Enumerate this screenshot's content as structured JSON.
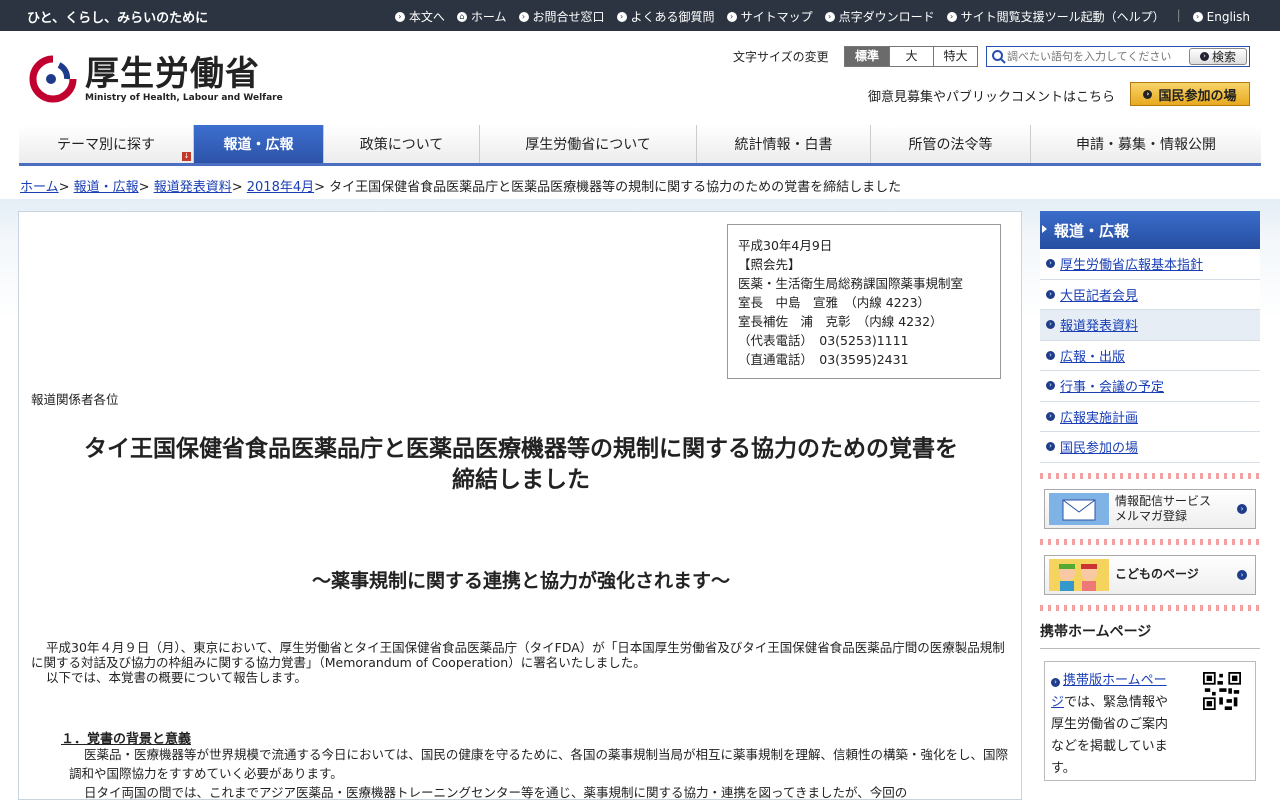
{
  "topbar": {
    "tagline": "ひと、くらし、みらいのために",
    "links": [
      {
        "label": "本文へ",
        "icon": "arrow-circle-icon"
      },
      {
        "label": "ホーム",
        "icon": "home-icon"
      },
      {
        "label": "お問合せ窓口",
        "icon": "arrow-circle-icon"
      },
      {
        "label": "よくある御質問",
        "icon": "arrow-circle-icon"
      },
      {
        "label": "サイトマップ",
        "icon": "arrow-circle-icon"
      },
      {
        "label": "点字ダウンロード",
        "icon": "arrow-circle-icon"
      },
      {
        "label": "サイト閲覧支援ツール起動（ヘルプ）",
        "icon": "arrow-circle-icon"
      },
      {
        "label": "English",
        "icon": "arrow-circle-icon"
      }
    ]
  },
  "header": {
    "logo_jp": "厚生労働省",
    "logo_en": "Ministry of Health, Labour and Welfare",
    "font_size_label": "文字サイズの変更",
    "font_sizes": [
      "標準",
      "大",
      "特大"
    ],
    "search_placeholder": "調べたい語句を入力してください",
    "search_button": "検索",
    "public_comment": "御意見募集やパブリックコメントはこちら",
    "participate_button": "国民参加の場"
  },
  "gnav": [
    "テーマ別に探す",
    "報道・広報",
    "政策について",
    "厚生労働省について",
    "統計情報・白書",
    "所管の法令等",
    "申請・募集・情報公開"
  ],
  "breadcrumb": {
    "links": [
      "ホーム",
      "報道・広報",
      "報道発表資料",
      "2018年4月"
    ],
    "current": "タイ王国保健省食品医薬品庁と医薬品医療機器等の規制に関する協力のための覚書を締結しました"
  },
  "contact": {
    "date": "平成30年4月9日",
    "heading": "【照会先】",
    "dept": "医薬・生活衛生局総務課国際薬事規制室",
    "chief": "室長　中島　宣雅　（内線 4223）",
    "assistant": "室長補佐　浦　克彰　（内線 4232）",
    "rep_phone": "（代表電話）　03(5253)1111",
    "direct_phone": "（直通電話）　03(3595)2431"
  },
  "article": {
    "addressee": "報道関係者各位",
    "title_line1": "タイ王国保健省食品医薬品庁と医薬品医療機器等の規制に関する協力のための覚書を",
    "title_line2": "締結しました",
    "subtitle": "～薬事規制に関する連携と協力が強化されます～",
    "intro_p1": "平成30年４月９日（月）、東京において、厚生労働省とタイ王国保健省食品医薬品庁（タイFDA）が「日本国厚生労働省及びタイ王国保健省食品医薬品庁間の医療製品規制に関する対話及び協力の枠組みに関する協力覚書」（Memorandum of Cooperation）に署名いたしました。",
    "intro_p2": "以下では、本覚書の概要について報告します。",
    "section1_heading": "１．覚書の背景と意義",
    "section1_p1": "医薬品・医療機器等が世界規模で流通する今日においては、国民の健康を守るために、各国の薬事規制当局が相互に薬事規制を理解、信頼性の構築・強化をし、国際調和や国際協力をすすめていく必要があります。",
    "section1_p2": "日タイ両国の間では、これまでアジア医薬品・医療機器トレーニングセンター等を通じ、薬事規制に関する協力・連携を図ってきましたが、今回の"
  },
  "sidebar": {
    "heading": "報道・広報",
    "items": [
      "厚生労働省広報基本指針",
      "大臣記者会見",
      "報道発表資料",
      "広報・出版",
      "行事・会議の予定",
      "広報実施計画",
      "国民参加の場"
    ],
    "banner_mail_line1": "情報配信サービス",
    "banner_mail_line2": "メルマガ登録",
    "banner_kids": "こどものページ",
    "mobile_heading": "携帯ホームページ",
    "mobile_link": "携帯版ホームページ",
    "mobile_text": "では、緊急情報や厚生労働省のご案内などを掲載しています。"
  },
  "colors": {
    "topbar_bg": "#2b3440",
    "nav_active": "#2d53a8",
    "link": "#1a3fb5",
    "participate_button": "#e8a920"
  }
}
